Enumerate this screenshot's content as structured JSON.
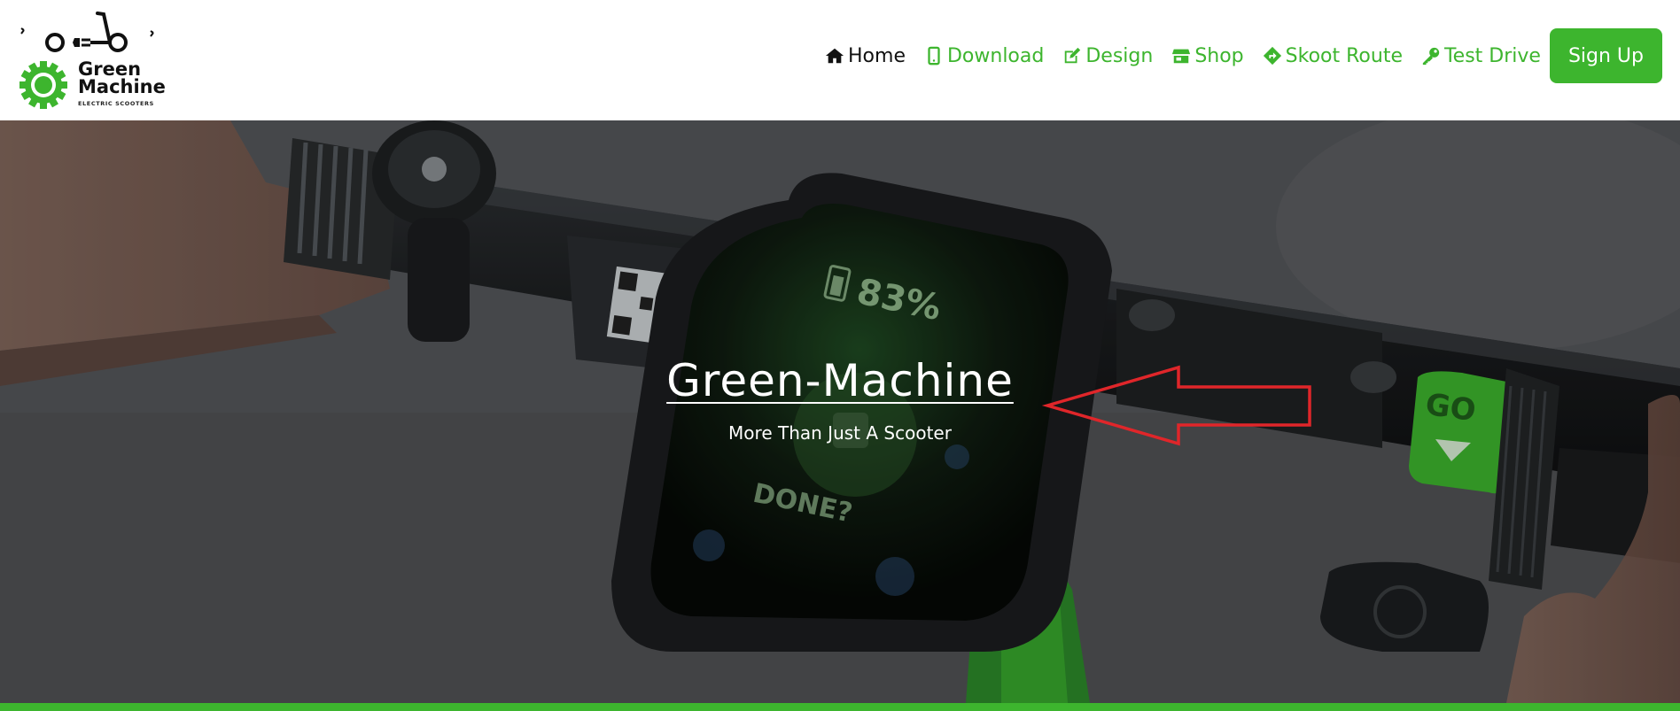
{
  "brand": {
    "name_line1": "Green",
    "name_line2": "Machine",
    "tagline": "ELECTRIC SCOOTERS",
    "color": "#3db52e"
  },
  "nav": {
    "items": [
      {
        "label": "Home",
        "icon": "home-icon",
        "active": true
      },
      {
        "label": "Download",
        "icon": "mobile-phone-icon",
        "active": false
      },
      {
        "label": "Design",
        "icon": "edit-icon",
        "active": false
      },
      {
        "label": "Shop",
        "icon": "store-icon",
        "active": false
      },
      {
        "label": "Skoot Route",
        "icon": "directions-icon",
        "active": false
      },
      {
        "label": "Test Drive",
        "icon": "key-icon",
        "active": false
      }
    ],
    "signup_label": "Sign Up"
  },
  "hero": {
    "title": "Green-Machine",
    "subtitle": "More Than Just A Scooter",
    "display_battery": "83%",
    "display_prompt": "DONE?",
    "throttle_label": "GO",
    "annotation": "red-arrow-pointing-left"
  },
  "colors": {
    "accent": "#3db52e",
    "arrow": "#e0262a"
  }
}
